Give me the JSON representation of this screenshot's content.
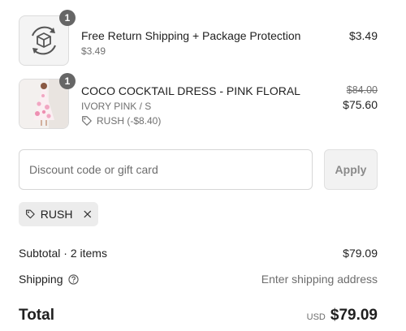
{
  "items": [
    {
      "title": "Free Return Shipping + Package Protection",
      "subtitle": "$3.49",
      "quantity": "1",
      "price": "$3.49",
      "icon": "package-protection-icon"
    },
    {
      "title": "COCO COCKTAIL DRESS - PINK FLORAL",
      "variant": "IVORY PINK / S",
      "discount_label": "RUSH (-$8.40)",
      "quantity": "1",
      "original_price": "$84.00",
      "price": "$75.60",
      "image": "pink-floral-dress-photo"
    }
  ],
  "discount": {
    "placeholder": "Discount code or gift card",
    "apply_label": "Apply",
    "applied_code": "RUSH"
  },
  "summary": {
    "subtotal_label": "Subtotal · 2 items",
    "subtotal_value": "$79.09",
    "shipping_label": "Shipping",
    "shipping_value": "Enter shipping address",
    "total_label": "Total",
    "currency": "USD",
    "total_value": "$79.09"
  },
  "colors": {
    "badge": "#666666",
    "dress_pink": "#f1a7c3",
    "dress_white": "#fbeef2"
  }
}
